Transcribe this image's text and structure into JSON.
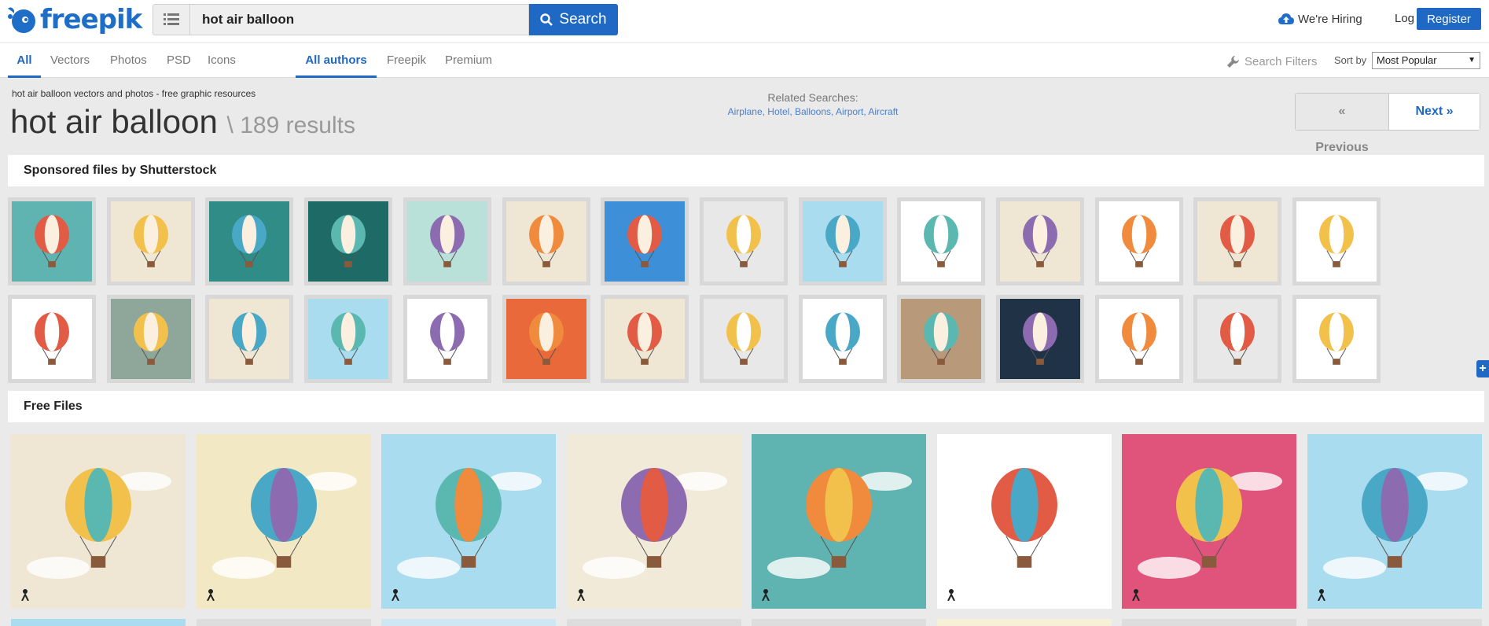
{
  "header": {
    "logo_text": "freepik",
    "search_value": "hot air balloon",
    "search_button": "Search",
    "hiring": "We're Hiring",
    "login": "Log in",
    "register": "Register"
  },
  "filters": {
    "type_tabs": [
      "All",
      "Vectors",
      "Photos",
      "PSD",
      "Icons"
    ],
    "author_tabs": [
      "All authors",
      "Freepik",
      "Premium"
    ],
    "search_filters": "Search Filters",
    "sort_label": "Sort by",
    "sort_value": "Most Popular"
  },
  "results": {
    "subtitle": "hot air balloon vectors and photos - free graphic resources",
    "title": "hot air balloon",
    "count": "\\ 189 results",
    "related_label": "Related Searches:",
    "related_links": "Airplane, Hotel, Balloons, Airport, Aircraft",
    "prev": "« Previous",
    "next": "Next »"
  },
  "sponsored": {
    "title": "Sponsored files by Shutterstock",
    "row1": [
      "teal",
      "cream",
      "teal-dark",
      "dark-teal",
      "mint",
      "cream",
      "blue",
      "grey",
      "sky",
      "white",
      "cream",
      "white",
      "cream",
      "white"
    ],
    "row2": [
      "white",
      "grey-green",
      "cream",
      "sky",
      "white",
      "orange",
      "cream",
      "grey",
      "white",
      "brown",
      "navy",
      "white",
      "grey",
      "white"
    ]
  },
  "free": {
    "title": "Free Files",
    "cards": [
      "cream",
      "yellow",
      "sky",
      "beige",
      "teal",
      "white",
      "pink",
      "sky"
    ]
  },
  "colors": {
    "accent": "#1f68c4",
    "balloon_red": "#e25b45",
    "teal": "#5bb8b0"
  }
}
